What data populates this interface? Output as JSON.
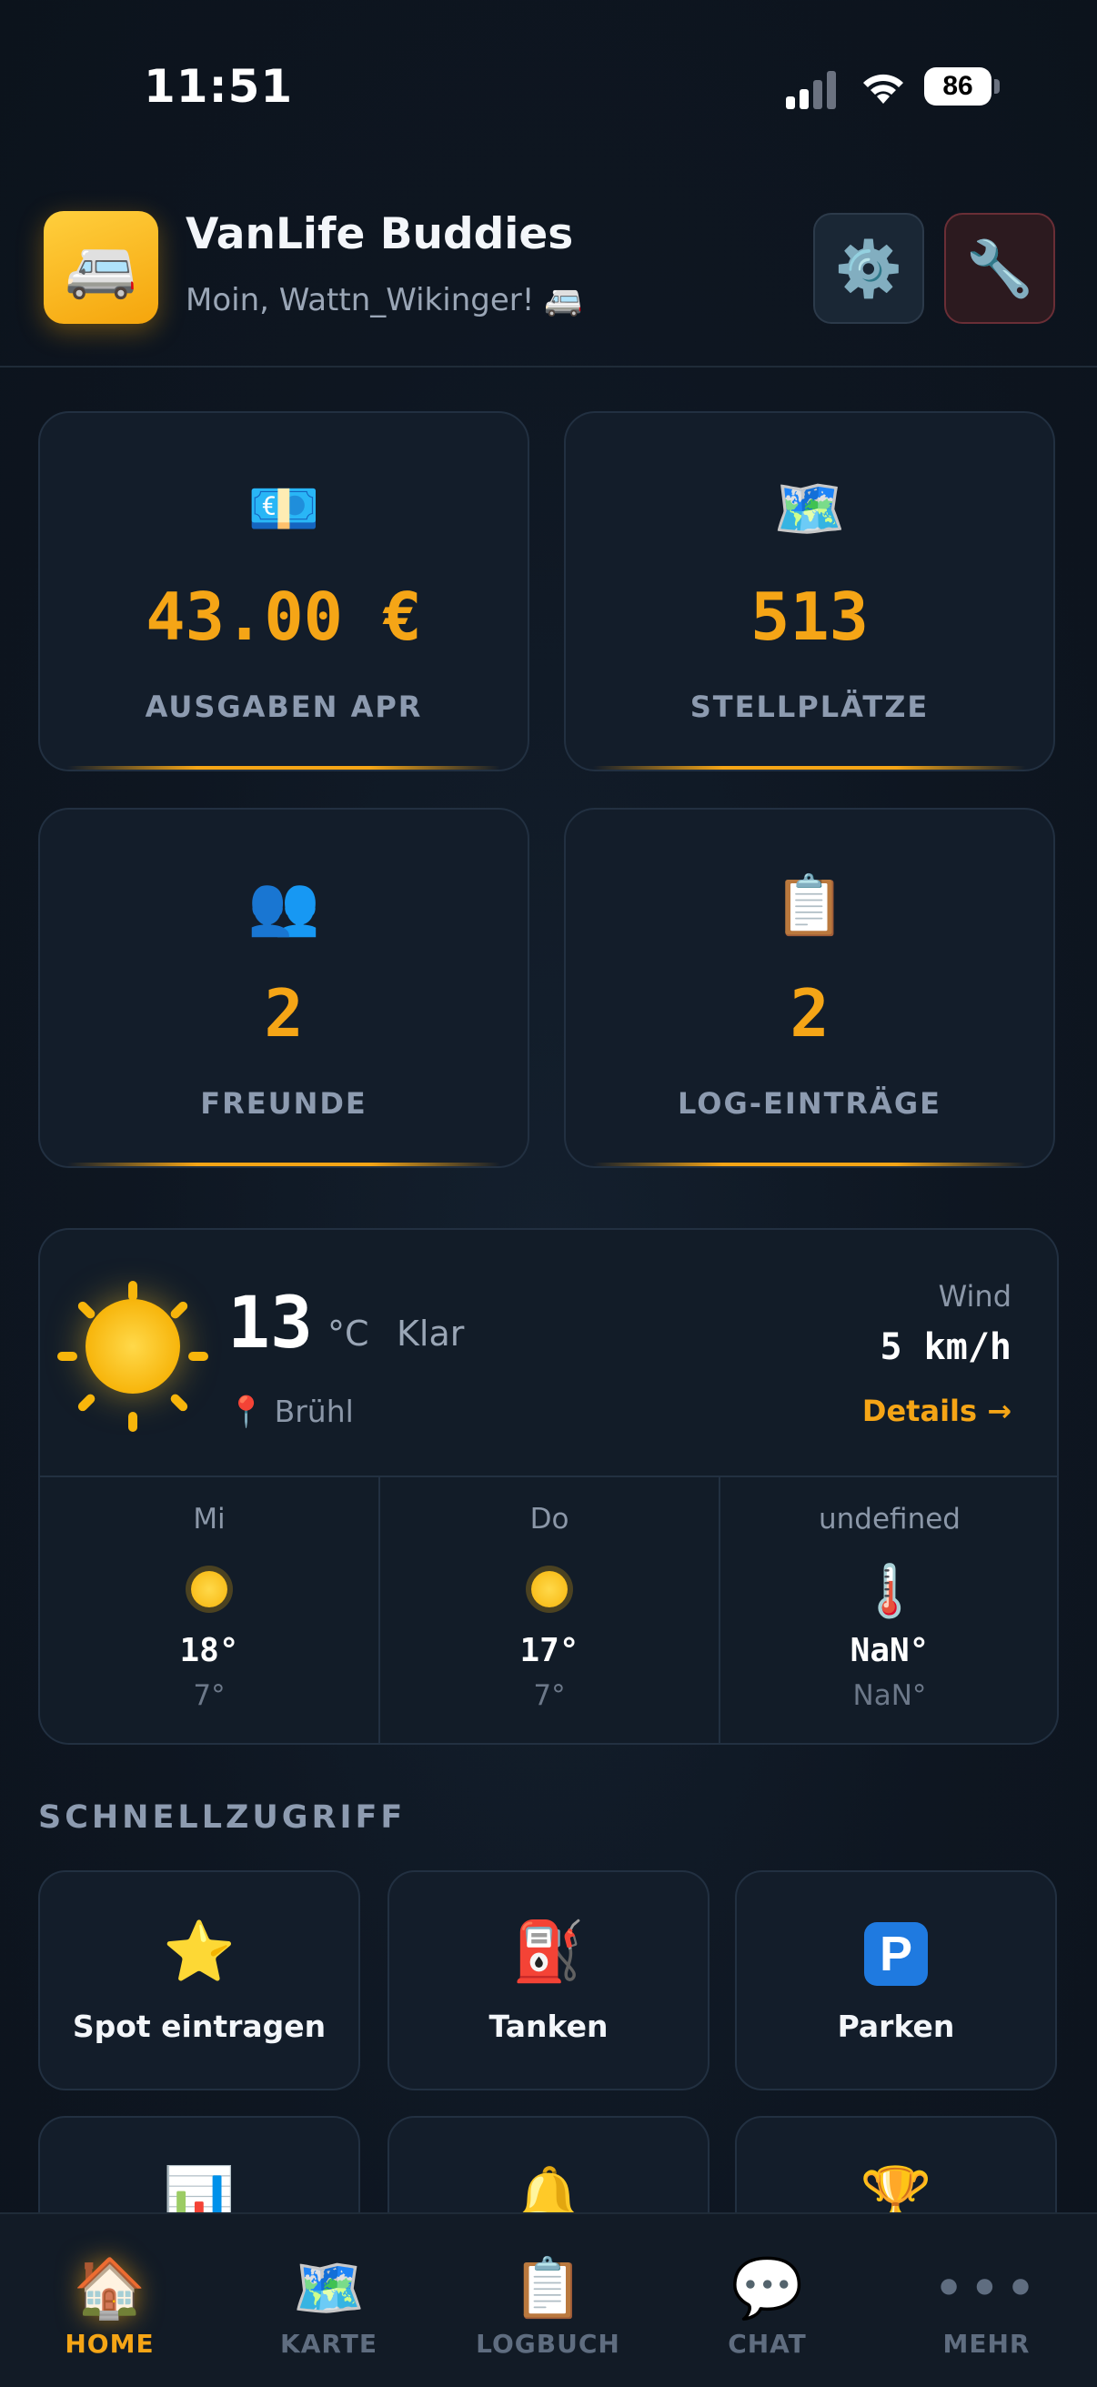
{
  "status_bar": {
    "time": "11:51",
    "battery": "86"
  },
  "header": {
    "app_icon": "🚐",
    "title": "VanLife Buddies",
    "greeting": "Moin, Wattn_Wikinger! 🚐",
    "settings_icon": "⚙️",
    "tools_icon": "🔧"
  },
  "stats": [
    {
      "icon": "💶",
      "value": "43.00 €",
      "label": "AUSGABEN APR"
    },
    {
      "icon": "🗺️",
      "value": "513",
      "label": "STELLPLÄTZE"
    },
    {
      "icon": "👥",
      "value": "2",
      "label": "FREUNDE"
    },
    {
      "icon": "📋",
      "value": "2",
      "label": "LOG-EINTRÄGE"
    }
  ],
  "weather": {
    "temp": "13",
    "unit": "°C",
    "condition": "Klar",
    "location": "📍 Brühl",
    "wind_label": "Wind",
    "wind_value": "5 km/h",
    "details_link": "Details →",
    "forecast": [
      {
        "day": "Mi",
        "icon": "sun",
        "high": "18°",
        "low": "7°"
      },
      {
        "day": "Do",
        "icon": "sun",
        "high": "17°",
        "low": "7°"
      },
      {
        "day": "undefined",
        "icon": "🌡️",
        "high": "NaN°",
        "low": "NaN°"
      }
    ]
  },
  "quick_access": {
    "title": "SCHNELLZUGRIFF",
    "items": [
      {
        "icon": "⭐",
        "label": "Spot eintragen"
      },
      {
        "icon": "⛽",
        "label": "Tanken"
      },
      {
        "icon": "P",
        "label": "Parken"
      },
      {
        "icon": "📊",
        "label": ""
      },
      {
        "icon": "🔔",
        "label": ""
      },
      {
        "icon": "🏆",
        "label": ""
      }
    ]
  },
  "bottom_nav": [
    {
      "icon": "🏠",
      "label": "HOME",
      "active": true
    },
    {
      "icon": "🗺️",
      "label": "KARTE"
    },
    {
      "icon": "📋",
      "label": "LOGBUCH"
    },
    {
      "icon": "💬",
      "label": "CHAT"
    },
    {
      "icon": "•••",
      "label": "MEHR"
    }
  ],
  "colors": {
    "accent": "#f5a516",
    "background": "#0e1621",
    "card": "#131d2a"
  }
}
